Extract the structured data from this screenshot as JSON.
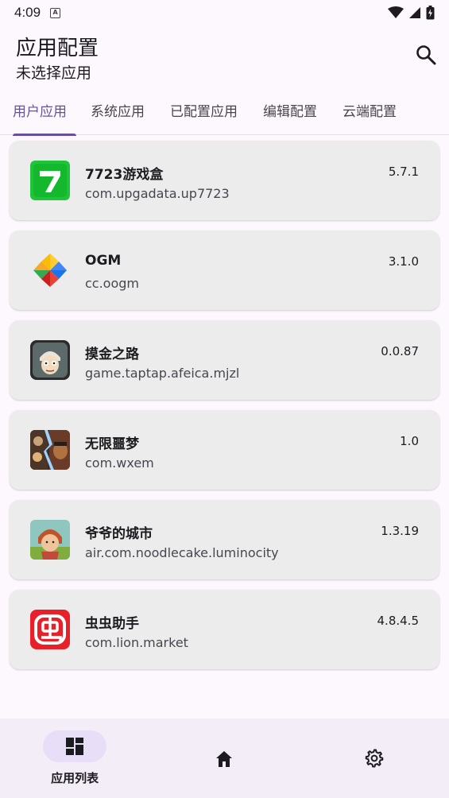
{
  "status_bar": {
    "time": "4:09"
  },
  "header": {
    "title": "应用配置",
    "subtitle": "未选择应用"
  },
  "tabs": [
    {
      "label": "用户应用",
      "active": true
    },
    {
      "label": "系统应用",
      "active": false
    },
    {
      "label": "已配置应用",
      "active": false
    },
    {
      "label": "编辑配置",
      "active": false
    },
    {
      "label": "云端配置",
      "active": false
    }
  ],
  "apps": [
    {
      "name": "7723游戏盒",
      "package": "com.upgadata.up7723",
      "version": "5.7.1"
    },
    {
      "name": "OGM",
      "package": "cc.oogm",
      "version": "3.1.0"
    },
    {
      "name": "摸金之路",
      "package": "game.taptap.afeica.mjzl",
      "version": "0.0.87"
    },
    {
      "name": "无限噩梦",
      "package": "com.wxem",
      "version": "1.0"
    },
    {
      "name": "爷爷的城市",
      "package": "air.com.noodlecake.luminocity",
      "version": "1.3.19"
    },
    {
      "name": "虫虫助手",
      "package": "com.lion.market",
      "version": "4.8.4.5"
    }
  ],
  "bottom_nav": {
    "app_list_label": "应用列表"
  },
  "colors": {
    "accent": "#6750a4",
    "card_bg": "#ececec",
    "nav_bg": "#f3edf7",
    "pill": "#e8def8"
  }
}
